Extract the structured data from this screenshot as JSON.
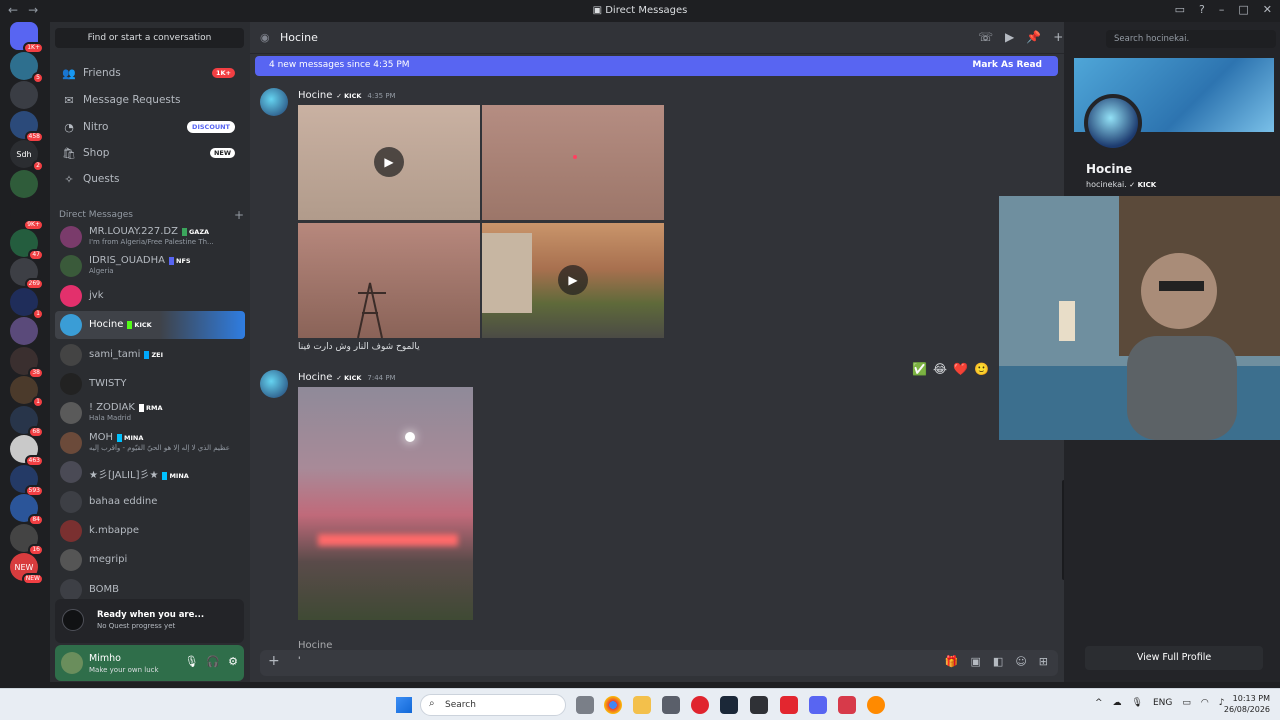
{
  "window": {
    "title": "Direct Messages"
  },
  "servers": {
    "badges": [
      "1K+",
      "5",
      "",
      "458",
      "2",
      "",
      "9K+",
      "47",
      "269",
      "1",
      "",
      "38",
      "1",
      "68",
      "463",
      "593",
      "84",
      "16",
      "NEW"
    ],
    "labels": [
      "",
      "",
      "",
      "",
      "Sdh",
      "",
      "",
      "",
      "",
      "",
      "",
      "",
      "",
      "",
      "",
      "",
      "",
      "",
      "NEW"
    ]
  },
  "sidebar": {
    "find_placeholder": "Find or start a conversation",
    "friends": {
      "label": "Friends",
      "badge": "1K+"
    },
    "message_requests": {
      "label": "Message Requests"
    },
    "nitro": {
      "label": "Nitro",
      "badge": "DISCOUNT"
    },
    "shop": {
      "label": "Shop",
      "badge": "NEW"
    },
    "quests": {
      "label": "Quests"
    },
    "dm_header": "Direct Messages",
    "dms": [
      {
        "name": "MR.LOUAY.227.DZ",
        "tag": "GAZA",
        "sub": "I'm from Algeria/Free Palestine Th..."
      },
      {
        "name": "IDRIS_OUADHA",
        "tag": "NFS",
        "sub": "Algeria"
      },
      {
        "name": "jvk",
        "tag": "",
        "sub": ""
      },
      {
        "name": "Hocine",
        "tag": "KICK",
        "sub": ""
      },
      {
        "name": "sami_tami",
        "tag": "ZEI",
        "sub": ""
      },
      {
        "name": "TWISTY",
        "tag": "",
        "sub": ""
      },
      {
        "name": "! ZODIAK",
        "tag": "RMA",
        "sub": "Hala Madrid"
      },
      {
        "name": "MOH",
        "tag": "MINA",
        "sub": "عظيم الذي لا إله إلا هو الحيّ القيّوم - وأقرب إليه"
      },
      {
        "name": "★彡[JALIL]彡★",
        "tag": "MINA",
        "sub": ""
      },
      {
        "name": "bahaa eddine",
        "tag": "",
        "sub": ""
      },
      {
        "name": "k.mbappe",
        "tag": "",
        "sub": ""
      },
      {
        "name": "megripi",
        "tag": "",
        "sub": ""
      },
      {
        "name": "BOMB",
        "tag": "",
        "sub": ""
      }
    ],
    "quest": {
      "title": "Ready when you are...",
      "sub": "No Quest progress yet"
    },
    "user": {
      "name": "Mimho",
      "status": "Make your own luck"
    }
  },
  "chat": {
    "channel_name": "Hocine",
    "new_messages": "4 new messages since 4:35 PM",
    "mark_read": "Mark As Read",
    "messages": [
      {
        "author": "Hocine",
        "tag": "KICK",
        "time": "4:35 PM",
        "caption": "يالموح شوف النار وش دارت فينا"
      },
      {
        "author": "Hocine",
        "tag": "KICK",
        "time": "7:44 PM"
      }
    ],
    "next_author": "Hocine",
    "reactions": [
      "✅",
      "😂",
      "❤️",
      "🙂"
    ],
    "composer_text": "'"
  },
  "profile": {
    "display_name": "Hocine",
    "username": "hocinekai.",
    "tag": "KICK",
    "view_full": "View Full Profile",
    "search_placeholder": "Search hocinekai."
  },
  "taskbar": {
    "search": "Search",
    "lang": "ENG",
    "time": "10:13 PM",
    "date": "26/08/2026"
  },
  "colors": {
    "blurple": "#5865f2",
    "green_tag": "#23a55a",
    "red_badge": "#f23f43"
  }
}
